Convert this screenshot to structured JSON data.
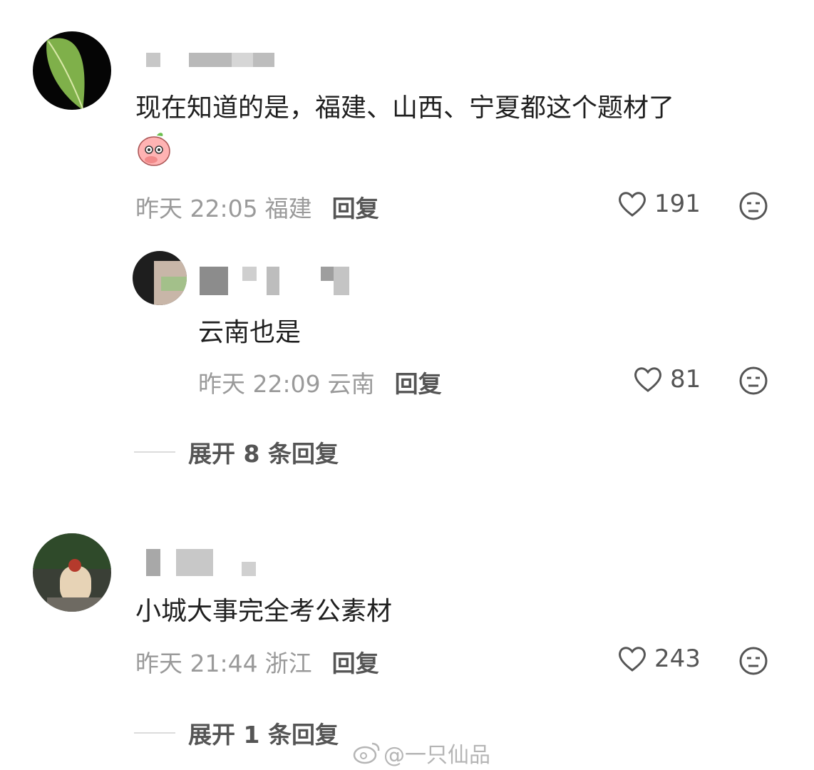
{
  "comments": [
    {
      "text": "现在知道的是，福建、山西、宁夏都这个题材了",
      "time": "昨天 22:05",
      "location": "福建",
      "reply_label": "回复",
      "likes": "191",
      "replies": [
        {
          "text": "云南也是",
          "time": "昨天 22:09",
          "location": "云南",
          "reply_label": "回复",
          "likes": "81"
        }
      ],
      "expand_label": "展开 8 条回复"
    },
    {
      "text": "小城大事完全考公素材",
      "time": "昨天 21:44",
      "location": "浙江",
      "reply_label": "回复",
      "likes": "243",
      "expand_label": "展开 1 条回复"
    }
  ],
  "watermark": "@一只仙品",
  "colors": {
    "meta": "#9a9a9a",
    "text": "#1f1f1f",
    "icon": "#555555"
  },
  "icons": [
    "heart-icon",
    "dislike-face-icon",
    "emoji-sticker",
    "weibo-logo-icon"
  ]
}
